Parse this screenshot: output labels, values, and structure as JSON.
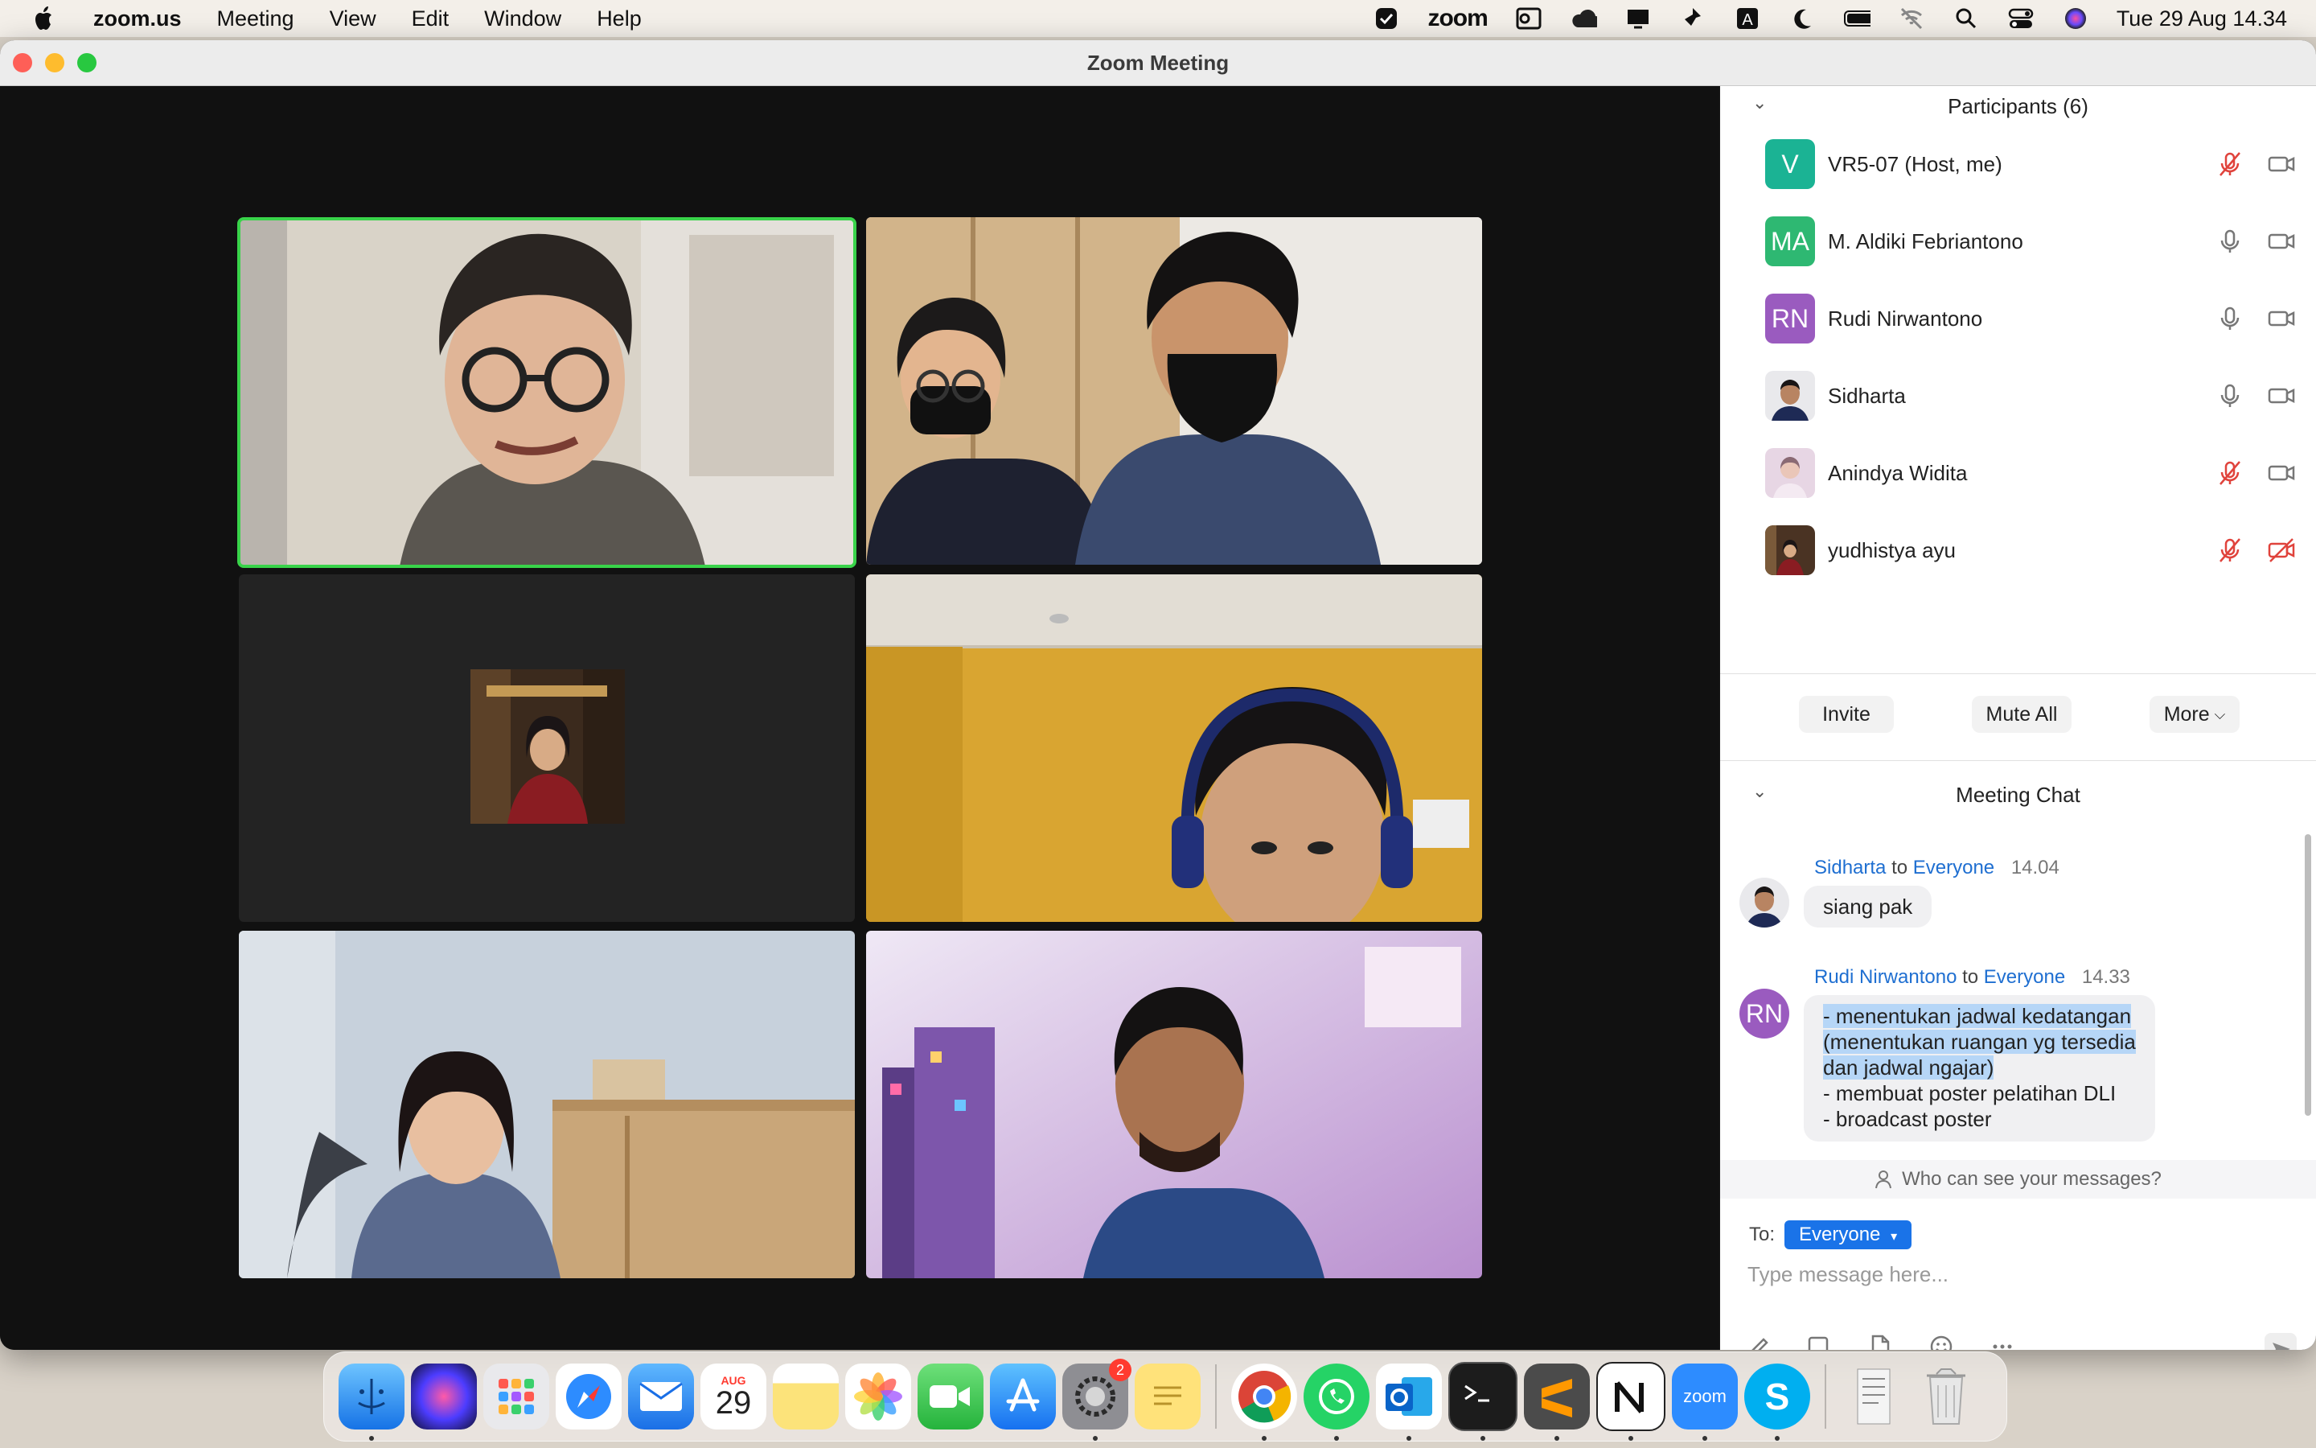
{
  "menubar": {
    "app_name": "zoom.us",
    "items": [
      "Meeting",
      "View",
      "Edit",
      "Window",
      "Help"
    ],
    "zoom_status": "zoom",
    "datetime": "Tue 29 Aug  14.34"
  },
  "window": {
    "title": "Zoom Meeting"
  },
  "participants": {
    "header": "Participants (6)",
    "list": [
      {
        "initials": "V",
        "name": "VR5-07 (Host, me)",
        "color": "#1bb394",
        "mic": "muted",
        "video": "on"
      },
      {
        "initials": "MA",
        "name": "M. Aldiki Febriantono",
        "color": "#2eb872",
        "mic": "on",
        "video": "on"
      },
      {
        "initials": "RN",
        "name": "Rudi Nirwantono",
        "color": "#9a5bbf",
        "mic": "on",
        "video": "on"
      },
      {
        "initials": "",
        "name": "Sidharta",
        "color": "#cccccc",
        "mic": "on",
        "video": "on"
      },
      {
        "initials": "",
        "name": "Anindya Widita",
        "color": "#d8c8d8",
        "mic": "muted",
        "video": "on"
      },
      {
        "initials": "",
        "name": "yudhistya ayu",
        "color": "#7a5a45",
        "mic": "muted",
        "video": "off"
      }
    ],
    "buttons": {
      "invite": "Invite",
      "mute_all": "Mute All",
      "more": "More"
    }
  },
  "chat": {
    "header": "Meeting Chat",
    "messages": [
      {
        "sender": "Sidharta",
        "to_word": "to",
        "recipient": "Everyone",
        "time": "14.04",
        "text": "siang pak"
      },
      {
        "sender": "Rudi Nirwantono",
        "to_word": "to",
        "recipient": "Everyone",
        "time": "14.33",
        "lines": [
          "- menentukan jadwal kedatangan",
          "(menentukan ruangan yg tersedia",
          "dan jadwal ngajar)",
          "- membuat poster pelatihan DLI",
          "- broadcast poster"
        ],
        "avatar_initials": "RN"
      }
    ],
    "who_can_see": "Who can see your messages?",
    "to_label": "To:",
    "to_value": "Everyone",
    "placeholder": "Type message here..."
  },
  "dock": {
    "calendar_month": "AUG",
    "calendar_day": "29",
    "settings_badge": "2",
    "zoom_label": "zoom"
  },
  "colors": {
    "active_speaker": "#39d34a",
    "link": "#1f6fd1",
    "accent": "#1a73e8",
    "muted_red": "#e0433c"
  }
}
